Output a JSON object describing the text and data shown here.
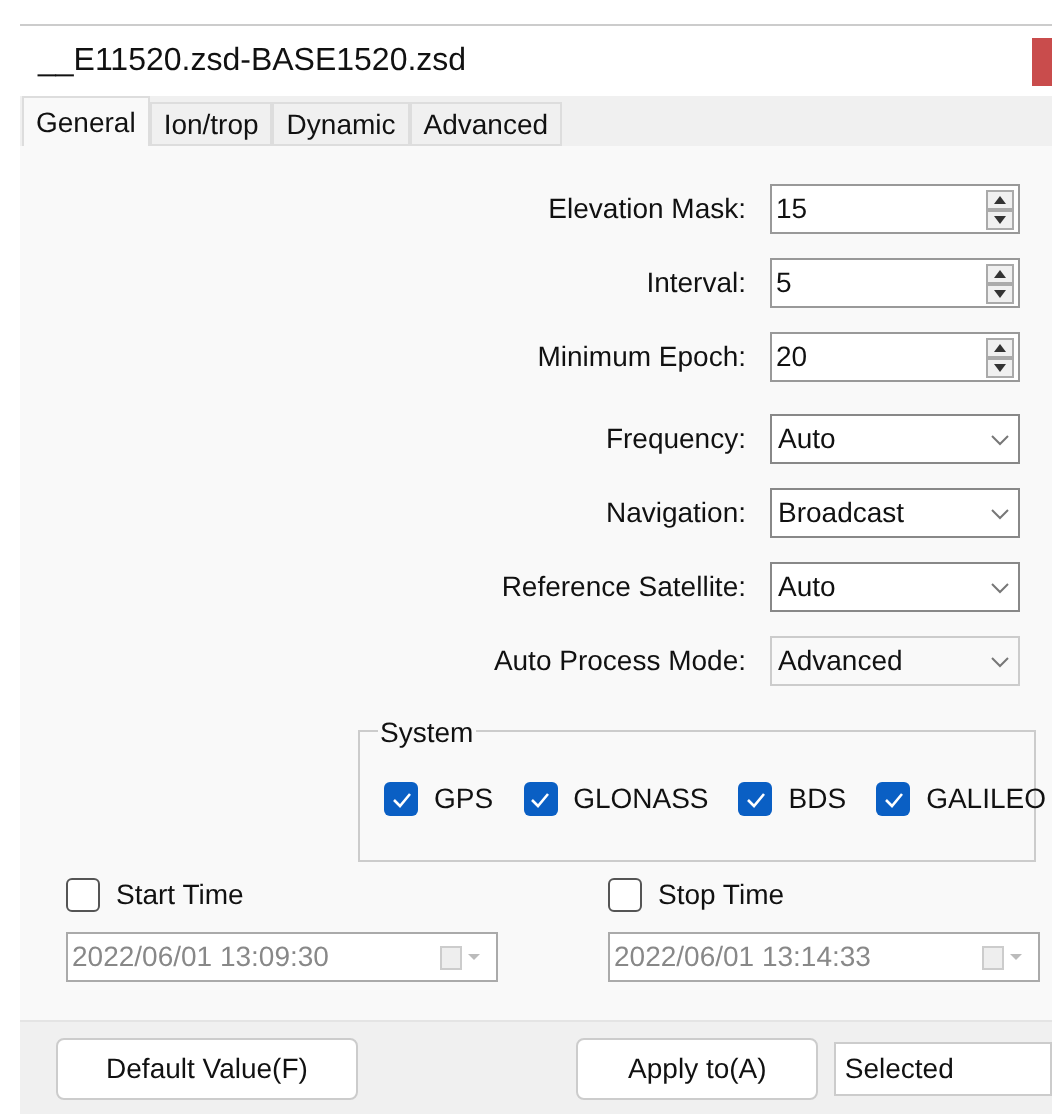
{
  "window": {
    "title": "__E11520.zsd-BASE1520.zsd"
  },
  "tabs": [
    {
      "label": "General",
      "selected": true
    },
    {
      "label": "Ion/trop",
      "selected": false
    },
    {
      "label": "Dynamic",
      "selected": false
    },
    {
      "label": "Advanced",
      "selected": false
    }
  ],
  "fields": [
    {
      "kind": "spin",
      "label": "Elevation Mask:",
      "value": "15"
    },
    {
      "kind": "spin",
      "label": "Interval:",
      "value": "5"
    },
    {
      "kind": "spin",
      "label": "Minimum Epoch:",
      "value": "20"
    },
    {
      "kind": "select",
      "label": "Frequency:",
      "value": "Auto"
    },
    {
      "kind": "select",
      "label": "Navigation:",
      "value": "Broadcast"
    },
    {
      "kind": "select",
      "label": "Reference Satellite:",
      "value": "Auto"
    },
    {
      "kind": "select",
      "label": "Auto Process Mode:",
      "value": "Advanced"
    }
  ],
  "system": {
    "title": "System",
    "items": [
      {
        "label": "GPS",
        "checked": true
      },
      {
        "label": "GLONASS",
        "checked": true
      },
      {
        "label": "BDS",
        "checked": true
      },
      {
        "label": "GALILEO",
        "checked": true
      }
    ]
  },
  "times": [
    {
      "label": "Start Time",
      "checked": false,
      "value": "2022/06/01 13:09:30"
    },
    {
      "label": "Stop Time",
      "checked": false,
      "value": "2022/06/01 13:14:33"
    }
  ],
  "footer": {
    "default_button": "Default Value(F)",
    "apply_button": "Apply to(A)",
    "apply_target": "Selected"
  }
}
